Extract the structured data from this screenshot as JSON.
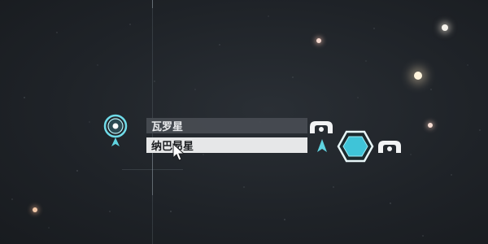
{
  "systems": [
    {
      "name": "瓦罗星",
      "selected": false
    },
    {
      "name": "纳巴昂星",
      "selected": true
    }
  ],
  "icons": {
    "current_location": "current-location-marker-icon",
    "player_ship": "player-ship-arrow-icon",
    "ship_class": "ship-class-icon",
    "faction": "hexagon-faction-icon"
  },
  "colors": {
    "accent": "#5fd3e0",
    "background": "#1f2328",
    "row_normal": "#484c52",
    "row_selected": "#e6e7e8"
  }
}
